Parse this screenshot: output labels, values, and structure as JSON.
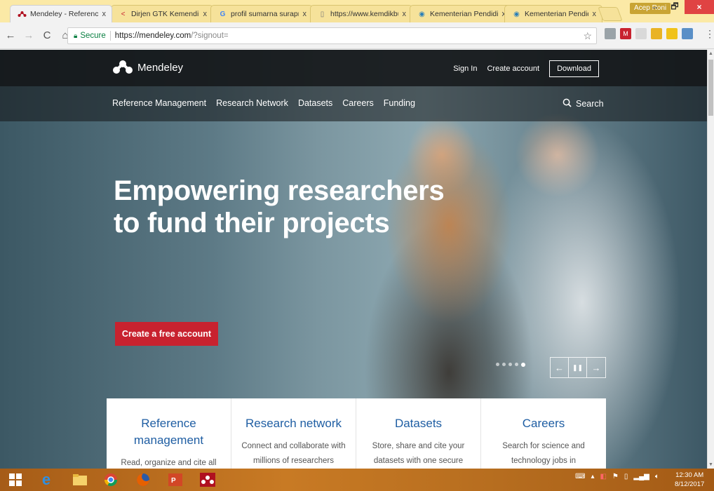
{
  "browser": {
    "tabs": [
      {
        "label": "Mendeley - Reference M",
        "icon": "mendeley-icon",
        "active": true
      },
      {
        "label": "Dirjen GTK Kemendikbu",
        "icon": "share-icon",
        "active": false
      },
      {
        "label": "profil sumarna surapran",
        "icon": "google-icon",
        "active": false
      },
      {
        "label": "https://www.kemdikbud",
        "icon": "page-icon",
        "active": false
      },
      {
        "label": "Kementerian Pendidikan",
        "icon": "globe-icon",
        "active": false
      },
      {
        "label": "Kementerian Pendidikan",
        "icon": "globe-icon",
        "active": false
      }
    ],
    "tab_close_glyph": "x",
    "user_chip": "Acep Roni",
    "window_controls": {
      "minimize": "–",
      "restore": "🗗",
      "close": "×"
    },
    "nav": {
      "back": "←",
      "forward": "→",
      "reload": "C",
      "home": "⌂"
    },
    "address": {
      "secure_label": "Secure",
      "url_host": "https://mendeley.com",
      "url_path": "/?signout="
    },
    "star_glyph": "☆",
    "menu_glyph": "⋮"
  },
  "site": {
    "logo_text": "Mendeley",
    "top_links": {
      "sign_in": "Sign In",
      "create_account": "Create account",
      "download": "Download"
    },
    "nav_items": [
      "Reference Management",
      "Research Network",
      "Datasets",
      "Careers",
      "Funding"
    ],
    "search_label": "Search",
    "search_glyph": "⚲",
    "hero": {
      "line1": "Empowering researchers",
      "line2": "to fund their projects",
      "cta": "Create a free account"
    },
    "carousel": {
      "prev": "←",
      "pause": "❚❚",
      "next": "→",
      "active_slide": 5,
      "slide_count": 5
    },
    "cards": [
      {
        "title": "Reference management",
        "text": "Read, organize and cite all"
      },
      {
        "title": "Research network",
        "text": "Connect and collaborate with millions of researchers"
      },
      {
        "title": "Datasets",
        "text": "Store, share and cite your datasets with one secure"
      },
      {
        "title": "Careers",
        "text": "Search for science and technology jobs in"
      }
    ]
  },
  "taskbar": {
    "icons": [
      "windows-start-icon",
      "internet-explorer-icon",
      "file-explorer-icon",
      "chrome-icon",
      "firefox-icon",
      "powerpoint-icon",
      "mendeley-icon"
    ],
    "clock_time": "12:30 AM",
    "clock_date": "8/12/2017"
  },
  "colors": {
    "brand_red": "#c8222f",
    "card_title_blue": "#1f5ea3",
    "tab_strip": "#fbe9a6",
    "taskbar": "#b96f1f"
  }
}
